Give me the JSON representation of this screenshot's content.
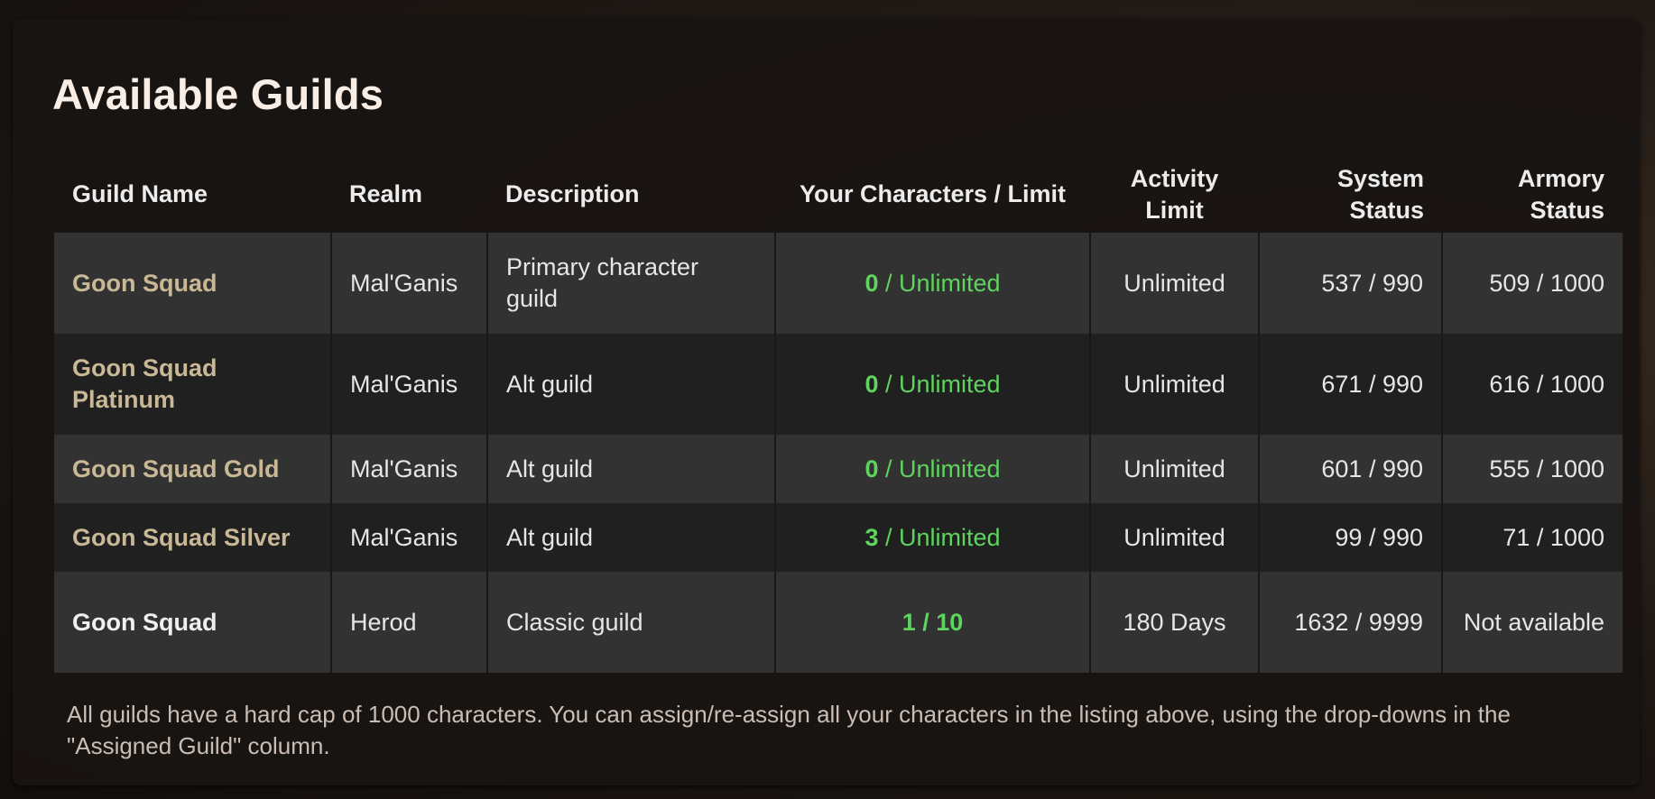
{
  "title": "Available Guilds",
  "colors": {
    "guild_name": "#c9b896",
    "count": "#5ed35e"
  },
  "columns": [
    "Guild Name",
    "Realm",
    "Description",
    "Your Characters / Limit",
    "Activity Limit",
    "System Status",
    "Armory Status"
  ],
  "rows": [
    {
      "name": "Goon Squad",
      "realm": "Mal'Ganis",
      "description": "Primary character guild",
      "count": "0",
      "limit": " / Unlimited",
      "activity": "Unlimited",
      "system": "537 / 990",
      "armory": "509 / 1000"
    },
    {
      "name": "Goon Squad Platinum",
      "realm": "Mal'Ganis",
      "description": "Alt guild",
      "count": "0",
      "limit": " / Unlimited",
      "activity": "Unlimited",
      "system": "671 / 990",
      "armory": "616 / 1000"
    },
    {
      "name": "Goon Squad Gold",
      "realm": "Mal'Ganis",
      "description": "Alt guild",
      "count": "0",
      "limit": " / Unlimited",
      "activity": "Unlimited",
      "system": "601 / 990",
      "armory": "555 / 1000"
    },
    {
      "name": "Goon Squad Silver",
      "realm": "Mal'Ganis",
      "description": "Alt guild",
      "count": "3",
      "limit": " / Unlimited",
      "activity": "Unlimited",
      "system": "99 / 990",
      "armory": "71 / 1000"
    },
    {
      "name": "Goon Squad",
      "realm": "Herod",
      "description": "Classic guild",
      "count": "1",
      "limit": " / 10",
      "activity": "180 Days",
      "system": "1632 / 9999",
      "armory": "Not available"
    }
  ],
  "note": "All guilds have a hard cap of 1000 characters. You can assign/re-assign all your characters in the listing above, using the drop-downs in the \"Assigned Guild\" column."
}
